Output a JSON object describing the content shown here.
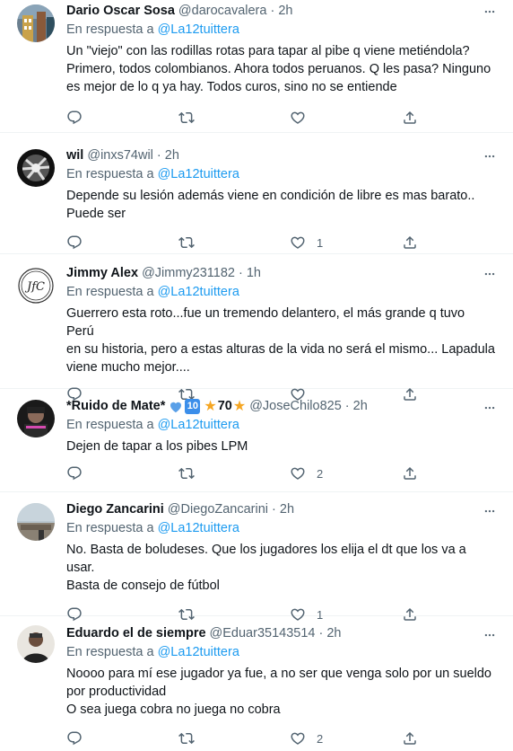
{
  "reply_prefix": "En respuesta a",
  "tweets": [
    {
      "name": "Dario Oscar Sosa",
      "handle": "@darocavalera",
      "time": "2h",
      "reply_to": "@La12tuittera",
      "text_lines": [
        "Un \"viejo\" con las rodillas rotas para tapar al pibe q viene metiéndola?",
        "Primero, todos colombianos. Ahora todos peruanos. Q les pasa? Ninguno",
        "es mejor de lo q ya hay. Todos curos, sino no se entiende"
      ],
      "likes": ""
    },
    {
      "name": "wil",
      "handle": "@inxs74wil",
      "time": "2h",
      "reply_to": "@La12tuittera",
      "text_lines": [
        "Depende su lesión además viene en condición de libre es mas barato..",
        "Puede ser"
      ],
      "likes": "1"
    },
    {
      "name": "Jimmy Alex",
      "handle": "@Jimmy231182",
      "time": "1h",
      "reply_to": "@La12tuittera",
      "text_lines": [
        "Guerrero esta roto...fue un tremendo delantero, el más grande q tuvo Perú",
        "en su historia, pero a estas alturas de la vida no será el mismo... Lapadula",
        "viene mucho mejor...."
      ],
      "likes": ""
    },
    {
      "name": "*Ruido de Mate*",
      "badge_box": "10",
      "badge_num": "70",
      "handle": "@JoseChilo825",
      "time": "2h",
      "reply_to": "@La12tuittera",
      "text_lines": [
        "Dejen de tapar a los pibes LPM"
      ],
      "likes": "2"
    },
    {
      "name": "Diego Zancarini",
      "handle": "@DiegoZancarini",
      "time": "2h",
      "reply_to": "@La12tuittera",
      "text_lines": [
        "No. Basta de boludeses. Que los jugadores los elija el dt que los va a usar.",
        "Basta de consejo de fútbol"
      ],
      "likes": "1"
    },
    {
      "name": "Eduardo el de siempre",
      "handle": "@Eduar35143514",
      "time": "2h",
      "reply_to": "@La12tuittera",
      "text_lines": [
        "Noooo para mí ese jugador ya fue, a no ser que venga solo por un sueldo",
        "por productividad",
        "O sea juega cobra no juega no cobra"
      ],
      "likes": "2"
    }
  ],
  "colors": {
    "text": "#0f1419",
    "secondary": "#536471",
    "link": "#1d9bf0",
    "divider": "#eff3f4"
  },
  "icons": {
    "reply": "comment-icon",
    "retweet": "retweet-icon",
    "like": "heart-icon",
    "share": "share-icon",
    "more": "more-icon"
  }
}
